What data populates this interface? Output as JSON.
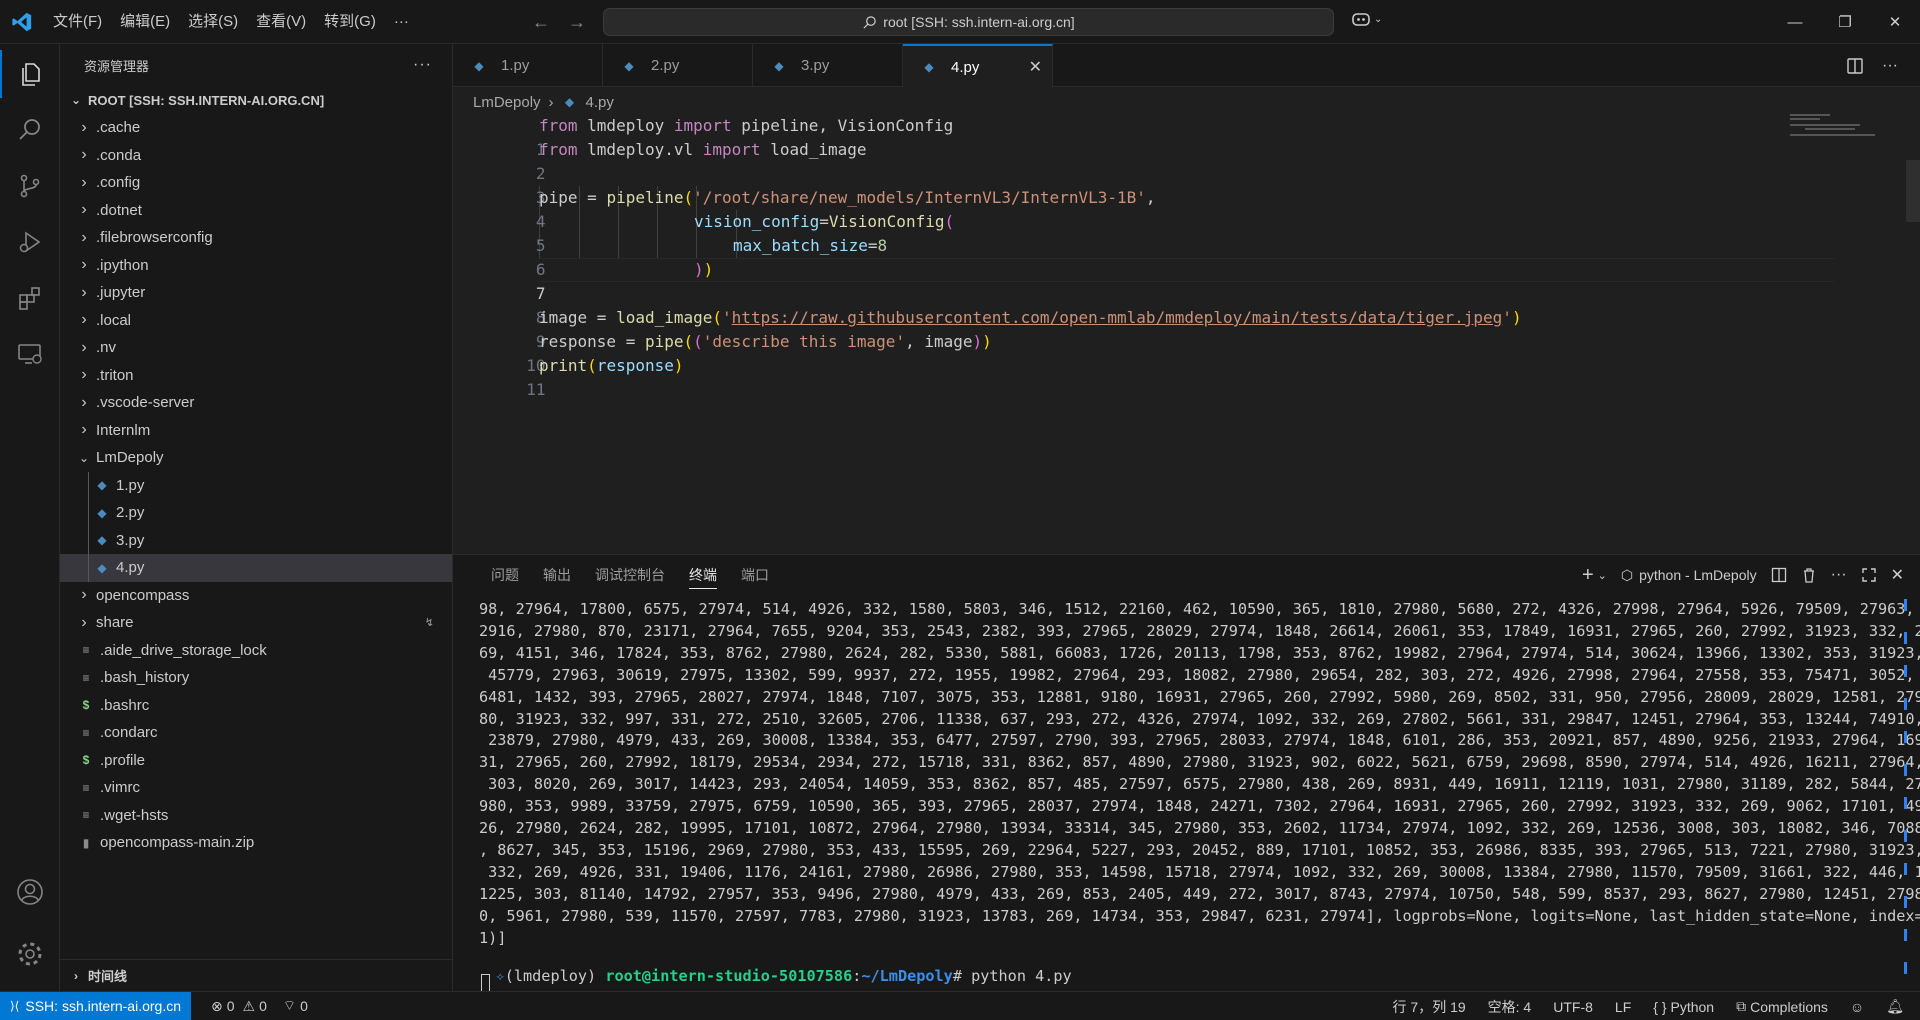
{
  "menu": [
    "文件(F)",
    "编辑(E)",
    "选择(S)",
    "查看(V)",
    "转到(G)",
    "···"
  ],
  "search": {
    "text": "root [SSH: ssh.intern-ai.org.cn]"
  },
  "explorer": {
    "title": "资源管理器",
    "root": "ROOT [SSH: SSH.INTERN-AI.ORG.CN]",
    "items": [
      {
        "name": ".cache",
        "type": "folder"
      },
      {
        "name": ".conda",
        "type": "folder"
      },
      {
        "name": ".config",
        "type": "folder"
      },
      {
        "name": ".dotnet",
        "type": "folder"
      },
      {
        "name": ".filebrowserconfig",
        "type": "folder"
      },
      {
        "name": ".ipython",
        "type": "folder"
      },
      {
        "name": ".jupyter",
        "type": "folder"
      },
      {
        "name": ".local",
        "type": "folder"
      },
      {
        "name": ".nv",
        "type": "folder"
      },
      {
        "name": ".triton",
        "type": "folder"
      },
      {
        "name": ".vscode-server",
        "type": "folder"
      },
      {
        "name": "Internlm",
        "type": "folder"
      },
      {
        "name": "LmDepoly",
        "type": "folder-open"
      },
      {
        "name": "1.py",
        "type": "python"
      },
      {
        "name": "2.py",
        "type": "python"
      },
      {
        "name": "3.py",
        "type": "python"
      },
      {
        "name": "4.py",
        "type": "python",
        "selected": true
      },
      {
        "name": "opencompass",
        "type": "folder"
      },
      {
        "name": "share",
        "type": "folder"
      },
      {
        "name": ".aide_drive_storage_lock",
        "type": "file"
      },
      {
        "name": ".bash_history",
        "type": "file"
      },
      {
        "name": ".bashrc",
        "type": "shell"
      },
      {
        "name": ".condarc",
        "type": "file"
      },
      {
        "name": ".profile",
        "type": "shell"
      },
      {
        "name": ".vimrc",
        "type": "file"
      },
      {
        "name": ".wget-hsts",
        "type": "file"
      },
      {
        "name": "opencompass-main.zip",
        "type": "zip"
      }
    ],
    "timeline": "时间线"
  },
  "tabs": [
    "1.py",
    "2.py",
    "3.py",
    "4.py"
  ],
  "breadcrumb": {
    "folder": "LmDepoly",
    "file": "4.py"
  },
  "code": {
    "line_numbers": [
      "1",
      "2",
      "3",
      "4",
      "5",
      "6",
      "7",
      "8",
      "9",
      "10",
      "11"
    ],
    "l1": {
      "kw1": "from",
      "mod": " lmdeploy ",
      "kw2": "import",
      "rest": " pipeline, VisionConfig"
    },
    "l2": {
      "kw1": "from",
      "mod": " lmdeploy.vl ",
      "kw2": "import",
      "rest": " load_image"
    },
    "l4": {
      "a": "pipe = ",
      "fn": "pipeline",
      "s": "'/root/share/new_models/InternVL3/InternVL3-1B'",
      "e": ","
    },
    "l5": {
      "arg": "vision_config",
      "eq": "=",
      "fn": "VisionConfig"
    },
    "l6": {
      "arg": "max_batch_size",
      "eq": "=",
      "num": "8"
    },
    "l9": {
      "a": "image = ",
      "fn": "load_image",
      "q1": "'",
      "url": "https://raw.githubusercontent.com/open-mmlab/mmdeploy/main/tests/data/tiger.jpeg",
      "q2": "'"
    },
    "l10": {
      "a": "response = ",
      "fn": "pipe",
      "s": "'describe this image'",
      "b": ", image"
    },
    "l11": {
      "fn": "print",
      "arg": "response"
    }
  },
  "panel": {
    "tabs": [
      "问题",
      "输出",
      "调试控制台",
      "终端",
      "端口"
    ],
    "terminal_name": "python - LmDepoly",
    "output_lines": [
      "98, 27964, 17800, 6575, 27974, 514, 4926, 332, 1580, 5803, 346, 1512, 22160, 462, 10590, 365, 1810, 27980, 5680, 272, 4326, 27998, 27964, 5926, 79509, 27963,",
      "2916, 27980, 870, 23171, 27964, 7655, 9204, 353, 2543, 2382, 393, 27965, 28029, 27974, 1848, 26614, 26061, 353, 17849, 16931, 27965, 260, 27992, 31923, 332, 2",
      "69, 4151, 346, 17824, 353, 8762, 27980, 2624, 282, 5330, 5881, 66083, 1726, 20113, 1798, 353, 8762, 19982, 27964, 27974, 514, 30624, 13966, 13302, 353, 31923,",
      " 45779, 27963, 30619, 27975, 13302, 599, 9937, 272, 1955, 19982, 27964, 293, 18082, 27980, 29654, 282, 303, 272, 4926, 27998, 27964, 27558, 353, 75471, 3052,",
      "6481, 1432, 393, 27965, 28027, 27974, 1848, 7107, 3075, 353, 12881, 9180, 16931, 27965, 260, 27992, 5980, 269, 8502, 331, 950, 27956, 28009, 28029, 12581, 279",
      "80, 31923, 332, 997, 331, 272, 2510, 32605, 2706, 11338, 637, 293, 272, 4326, 27974, 1092, 332, 269, 27802, 5661, 331, 29847, 12451, 27964, 353, 13244, 74910,",
      " 23879, 27980, 4979, 433, 269, 30008, 13384, 353, 6477, 27597, 2790, 393, 27965, 28033, 27974, 1848, 6101, 286, 353, 20921, 857, 4890, 9256, 21933, 27964, 169",
      "31, 27965, 260, 27992, 18179, 29534, 2934, 272, 15718, 331, 8362, 857, 4890, 27980, 31923, 902, 6022, 5621, 6759, 29698, 8590, 27974, 514, 4926, 16211, 27964,",
      " 303, 8020, 269, 3017, 14423, 293, 24054, 14059, 353, 8362, 857, 485, 27597, 6575, 27980, 438, 269, 8931, 449, 16911, 12119, 1031, 27980, 31189, 282, 5844, 27",
      "980, 353, 9989, 33759, 27975, 6759, 10590, 365, 393, 27965, 28037, 27974, 1848, 24271, 7302, 27964, 16931, 27965, 260, 27992, 31923, 332, 269, 9062, 17101, 49",
      "26, 27980, 2624, 282, 19995, 17101, 10872, 27964, 27980, 13934, 33314, 345, 27980, 353, 2602, 11734, 27974, 1092, 332, 269, 12536, 3008, 303, 18082, 346, 7088",
      ", 8627, 345, 353, 15196, 2969, 27980, 353, 433, 15595, 269, 22964, 5227, 293, 20452, 889, 17101, 10852, 353, 26986, 8335, 393, 27965, 513, 7221, 27980, 31923,",
      " 332, 269, 4926, 331, 19406, 1176, 24161, 27980, 26986, 27980, 353, 14598, 15718, 27974, 1092, 332, 269, 30008, 13384, 27980, 11570, 79509, 31661, 322, 446, 1",
      "1225, 303, 81140, 14792, 27957, 353, 9496, 27980, 4979, 433, 269, 853, 2405, 449, 272, 3017, 8743, 27974, 10750, 548, 599, 8537, 293, 8627, 27980, 12451, 2798",
      "0, 5961, 27980, 539, 11570, 27597, 7783, 27980, 31923, 13783, 269, 14734, 353, 29847, 6231, 27974], logprobs=None, logits=None, last_hidden_state=None, index=",
      "1)]"
    ],
    "prompt": {
      "env": "(lmdeploy) ",
      "user": "root@intern-studio-50107586",
      "sep": ":",
      "path": "~/LmDepoly",
      "cmd": "# python 4.py"
    }
  },
  "status": {
    "remote": "SSH: ssh.intern-ai.org.cn",
    "errors": "0",
    "warnings": "0",
    "ports": "0",
    "position": "行 7，列 19",
    "spaces": "空格: 4",
    "encoding": "UTF-8",
    "eol": "LF",
    "language": "Python",
    "completions": "Completions"
  },
  "icons": [
    "vscode-logo-icon",
    "files-icon",
    "search-icon",
    "source-control-icon",
    "run-debug-icon",
    "extensions-icon",
    "remote-explorer-icon",
    "account-icon",
    "settings-gear-icon",
    "copilot-icon",
    "python-icon",
    "close-icon",
    "split-editor-icon",
    "more-icon",
    "plus-icon",
    "trash-icon",
    "maximize-icon",
    "bell-icon"
  ],
  "colors": {
    "accent": "#0078d4",
    "editor_bg": "#1f1f1f",
    "sidebar_bg": "#181818",
    "keyword": "#c586c0",
    "function": "#dcdcaa",
    "string": "#ce9178",
    "variable": "#9cdcfe",
    "number": "#b5cea8",
    "prompt_green": "#23d18b",
    "prompt_blue": "#3b8eea"
  }
}
